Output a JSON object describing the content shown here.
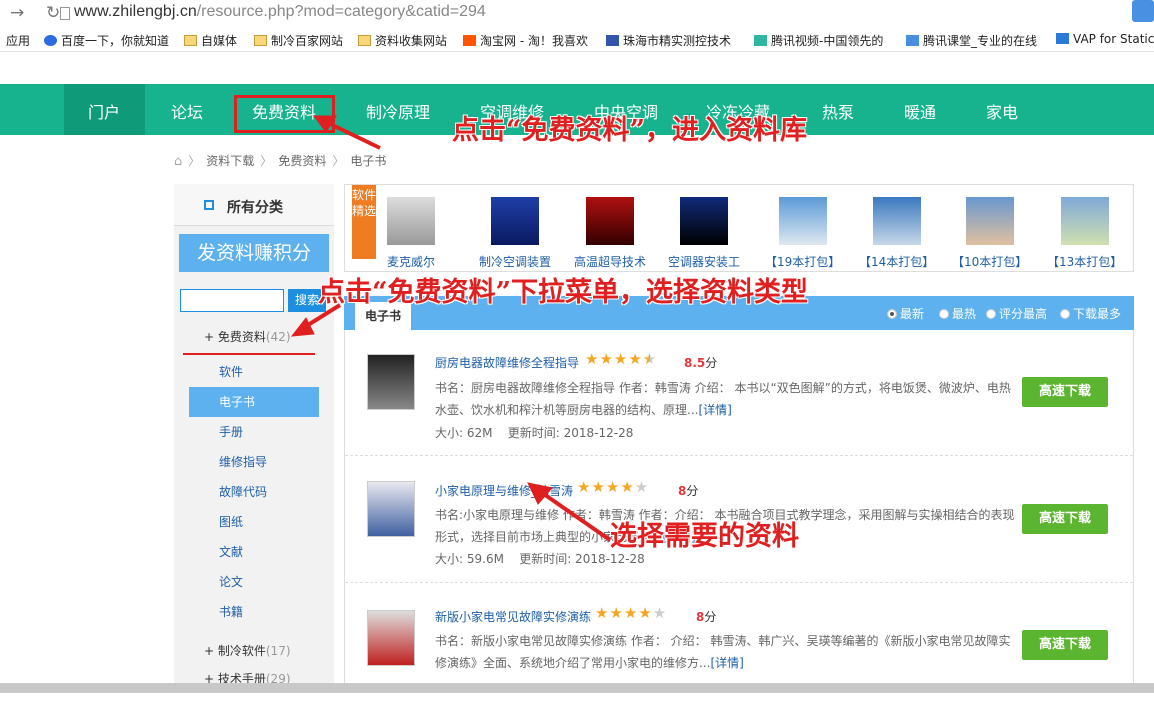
{
  "browser": {
    "url_main": "www.zhilengbj.cn",
    "url_path": "/resource.php?mod=category&catid=294",
    "bookmarks": [
      "应用",
      "百度一下，你就知道",
      "自媒体",
      "制冷百家网站",
      "资料收集网站",
      "淘宝网 - 淘！我喜欢",
      "珠海市精实测控技术",
      "腾讯视频-中国领先的",
      "腾讯课堂_专业的在线",
      "VAP for Static"
    ]
  },
  "nav": {
    "items": [
      "门户",
      "论坛",
      "免费资料",
      "制冷原理",
      "空调维修",
      "中央空调",
      "冷冻冷藏",
      "热泵",
      "暖通",
      "家电"
    ]
  },
  "breadcrumb": [
    "资料下载",
    "免费资料",
    "电子书"
  ],
  "sidebar": {
    "all_label": "所有分类",
    "earn_label": "发资料赚积分",
    "search_button": "搜索",
    "cat_free": "+ 免费资料",
    "cat_free_count": "(42)",
    "subs": [
      "软件",
      "电子书",
      "手册",
      "维修指导",
      "故障代码",
      "图纸",
      "文献",
      "论文",
      "书籍"
    ],
    "cat_soft": "+ 制冷软件",
    "cat_soft_count": "(17)",
    "cat_manual": "+ 技术手册",
    "cat_manual_count": "(29)"
  },
  "soft_pick": {
    "tag": "软件精选",
    "items": [
      "麦克威尔",
      "制冷空调装置",
      "高温超导技术",
      "空调器安装工",
      "【19本打包】",
      "【14本打包】",
      "【10本打包】",
      "【13本打包】"
    ]
  },
  "list_tabs": {
    "tab": "电子书",
    "sorts": [
      "最新",
      "最热",
      "评分最高",
      "下载最多"
    ]
  },
  "resources": [
    {
      "title": "厨房电器故障维修全程指导",
      "stars": 4.5,
      "score": "8.5",
      "score_unit": "分",
      "desc": "书名：厨房电器故障维修全程指导 作者：韩雪涛 介绍： 本书以“双色图解”的方式，将电饭煲、微波炉、电热水壶、饮水机和榨汁机等厨房电器的结构、原理...",
      "more": "[详情]",
      "size": "大小: 62M",
      "updated": "更新时间: 2018-12-28",
      "button": "高速下载"
    },
    {
      "title": "小家电原理与维修_韩雪涛",
      "stars": 4,
      "score": "8",
      "score_unit": "分",
      "desc": "书名:小家电原理与维修 作者：韩雪涛 作者：介绍： 本书融合项目式教学理念，采用图解与实操相结合的表现形式，选择目前市场上典型的小家电产品...",
      "more": "[详情]",
      "size": "大小: 59.6M",
      "updated": "更新时间: 2018-12-28",
      "button": "高速下载"
    },
    {
      "title": "新版小家电常见故障实修演练",
      "stars": 4,
      "score": "8",
      "score_unit": "分",
      "desc": "书名：新版小家电常见故障实修演练 作者： 介绍： 韩雪涛、韩广兴、吴瑛等编著的《新版小家电常见故障实修演练》全面、系统地介绍了常用小家电的维修方...",
      "more": "[详情]",
      "button": "高速下载"
    }
  ],
  "annotations": {
    "a1": "点击“免费资料”，进入资料库",
    "a2": "点击“免费资料”下拉菜单，选择资料类型",
    "a3": "选择需要的资料"
  }
}
